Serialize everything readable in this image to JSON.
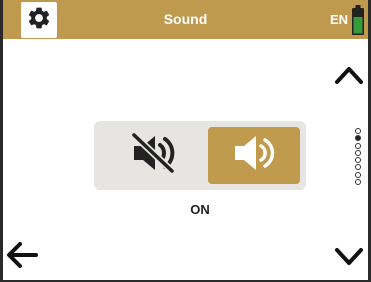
{
  "header": {
    "title": "Sound",
    "language": "EN",
    "settings_icon": "gear-icon",
    "battery_icon": "battery-icon"
  },
  "sound_toggle": {
    "off_icon": "speaker-muted-icon",
    "on_icon": "speaker-on-icon",
    "selected": "on",
    "status_label": "ON"
  },
  "navigation": {
    "up_icon": "chevron-up-icon",
    "down_icon": "chevron-down-icon",
    "back_icon": "arrow-left-icon"
  },
  "pager": {
    "total_pages": 8,
    "current_page": 2
  },
  "colors": {
    "accent": "#bf9a4e",
    "toggle_bg": "#e7e5e2",
    "battery_green": "#3a9b3a"
  }
}
